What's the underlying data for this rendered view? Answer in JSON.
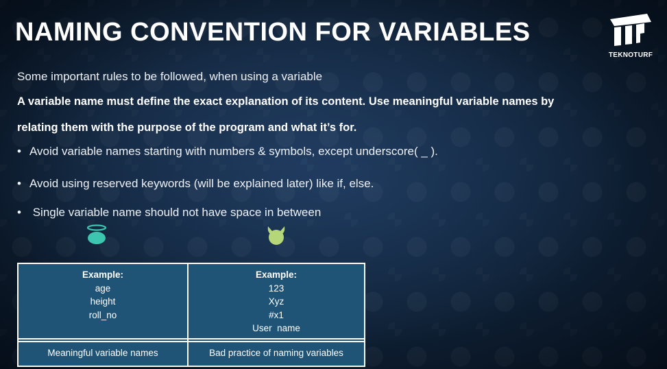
{
  "slide": {
    "title": "NAMING CONVENTION FOR VARIABLES",
    "logo_text": "TEKNOTURF",
    "intro": "Some important rules to be followed, when using a variable",
    "bold_lines": [
      "A variable name must define the exact explanation of its content. Use meaningful variable names by",
      "relating them with the purpose of the program and what it’s for."
    ],
    "bullets": [
      "Avoid variable names starting with numbers & symbols, except underscore( _ ).",
      "Avoid using reserved keywords (will be explained later) like if, else.",
      " Single variable name should not have space in between"
    ],
    "icons": {
      "good": "angel-icon",
      "bad": "devil-icon",
      "good_color": "#3cc6b0",
      "bad_color": "#b5d77a"
    }
  },
  "table": {
    "good": {
      "heading": "Example:",
      "items": [
        "age",
        "height",
        "roll_no"
      ],
      "label": "Meaningful variable names"
    },
    "bad": {
      "heading": "Example:",
      "items": [
        "123",
        "Xyz",
        "#x1",
        "User  name"
      ],
      "label": "Bad practice of naming variables"
    }
  },
  "colors": {
    "table_bg": "#1f5477",
    "background": "#0f2136"
  }
}
